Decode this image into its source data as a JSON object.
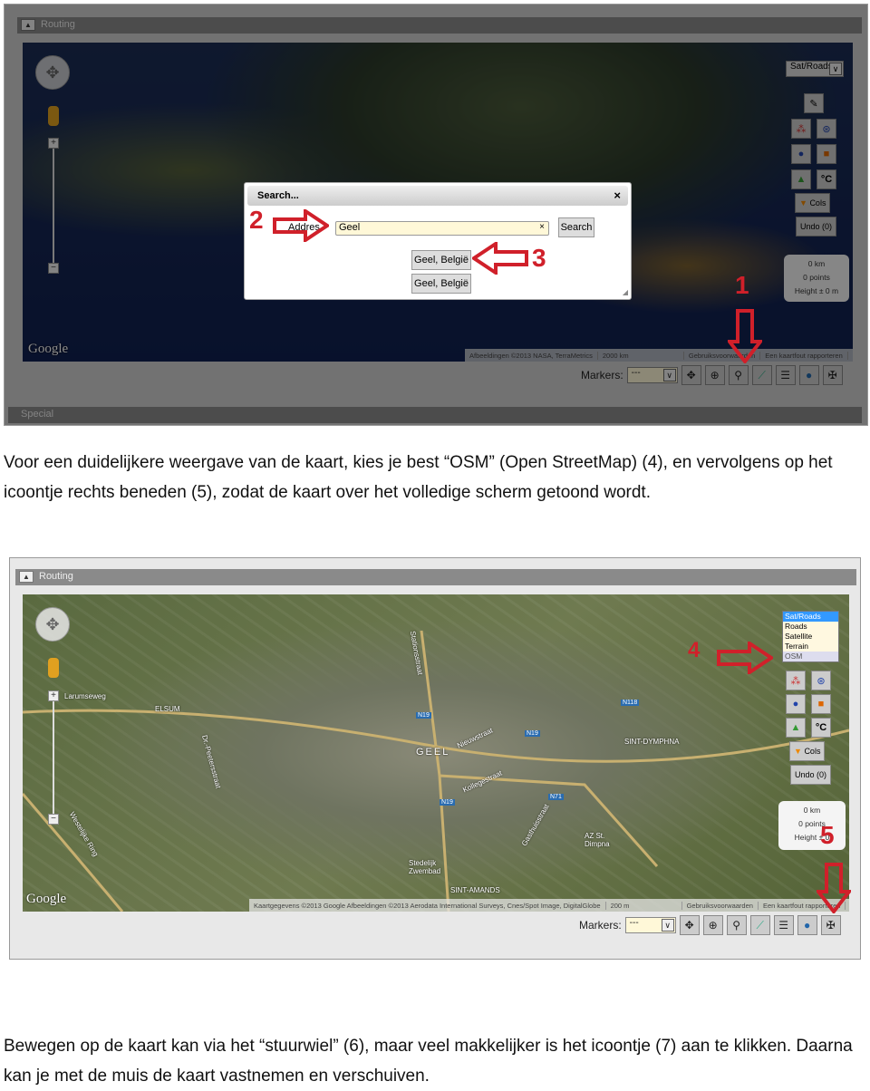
{
  "screenshot1": {
    "routing_bar": "Routing",
    "special_bar": "Special",
    "map_type_select": "Sat/Roads",
    "google_logo": "Google",
    "attribution": [
      "Afbeeldingen ©2013 NASA, TerraMetrics",
      "2000 km",
      "Gebruiksvoorwaarden",
      "Een kaartfout rapporteren"
    ],
    "side_buttons": {
      "cols": "Cols",
      "undo": "Undo (0)",
      "temp": "°C"
    },
    "info": {
      "distance": "0 km",
      "points": "0 points",
      "height": "Height ± 0 m"
    },
    "markers_label": "Markers:",
    "markers_value": "---",
    "search_dialog": {
      "title": "Search...",
      "close": "×",
      "address_label": "Addres",
      "input_value": "Geel",
      "clear": "×",
      "search_button": "Search",
      "results": [
        "Geel, België",
        "Geel, België"
      ]
    },
    "annotations": [
      "1",
      "2",
      "3"
    ]
  },
  "paragraph1": "Voor een duidelijkere weergave van de kaart, kies je best “OSM” (Open StreetMap) (4), en vervolgens op het icoontje rechts beneden (5), zodat de kaart over het volledige scherm getoond wordt.",
  "screenshot2": {
    "routing_bar": "Routing",
    "google_logo": "Google",
    "map_type_options": [
      "Sat/Roads",
      "Roads",
      "Satellite",
      "Terrain",
      "OSM"
    ],
    "map_labels": [
      "Larumseweg",
      "ELSUM",
      "GEEL",
      "Nieuwstraat",
      "SINT-DYMPHNA",
      "Kollegestraat",
      "Dr.-Peetersstraat",
      "Westelijke Ring",
      "Stedelijk Zwembad",
      "SINT-AMANDS",
      "Gasthuisstraat",
      "AZ St. Dimpna",
      "Stationsstraat",
      "N19",
      "N19",
      "N19",
      "N118",
      "N71"
    ],
    "attribution": [
      "Kaartgegevens ©2013 Google Afbeeldingen ©2013 Aerodata International Surveys, Cnes/Spot Image, DigitalGlobe",
      "200 m",
      "Gebruiksvoorwaarden",
      "Een kaartfout rapporteren"
    ],
    "side_buttons": {
      "cols": "Cols",
      "undo": "Undo (0)",
      "temp": "°C"
    },
    "info": {
      "distance": "0 km",
      "points": "0 points",
      "height": "Height ± 0"
    },
    "markers_label": "Markers:",
    "markers_value": "---",
    "annotations": [
      "4",
      "5"
    ]
  },
  "paragraph2": "Bewegen op de kaart kan via het “stuurwiel” (6), maar veel makkelijker is het icoontje (7) aan te klikken. Daarna kan je met de muis de kaart vastnemen en verschuiven.",
  "colors": {
    "annotation_red": "#d0202a",
    "selected_option": "#3399ff",
    "input_bg": "#fff8d8"
  },
  "icons": [
    "pan-icon",
    "crosshair-icon",
    "search-icon",
    "route-icon",
    "list-icon",
    "globe-icon",
    "fullscreen-icon"
  ]
}
